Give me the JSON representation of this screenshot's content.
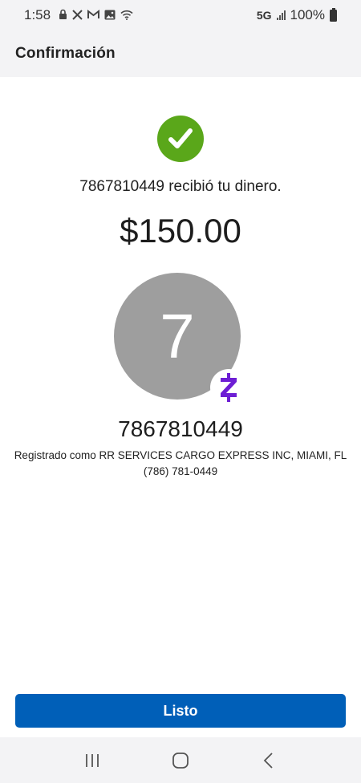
{
  "status_bar": {
    "time": "1:58",
    "network": "5G",
    "battery": "100%",
    "icons": [
      "lock-icon",
      "x-icon",
      "gmail-icon",
      "gallery-icon",
      "wifi-icon"
    ]
  },
  "header": {
    "title": "Confirmación"
  },
  "confirmation": {
    "message": "7867810449 recibió tu dinero.",
    "amount": "$150.00",
    "success_color": "#5aa71a"
  },
  "recipient": {
    "avatar_initial": "7",
    "avatar_color": "#9e9e9e",
    "name": "7867810449",
    "registered_as": "Registrado como RR SERVICES CARGO EXPRESS INC, MIAMI, FL",
    "phone": "(786) 781-0449",
    "badge": "zelle-icon",
    "badge_color": "#6d1ed4"
  },
  "actions": {
    "done_label": "Listo",
    "button_color": "#005fb8"
  },
  "nav_bar": {
    "buttons": [
      "recents-icon",
      "home-icon",
      "back-icon"
    ]
  }
}
